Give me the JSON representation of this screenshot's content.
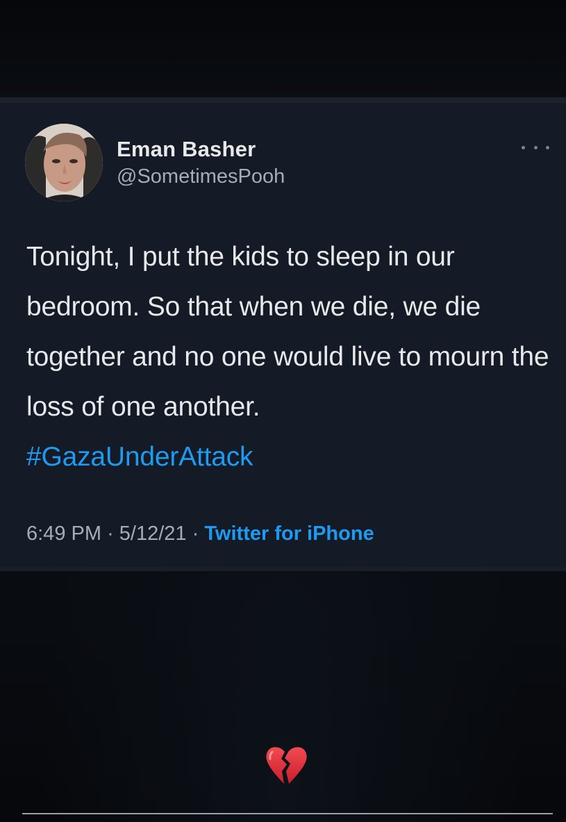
{
  "tweet": {
    "author": {
      "display_name": "Eman Basher",
      "handle": "@SometimesPooh"
    },
    "text": "Tonight, I put the kids to sleep in our bedroom. So that when we die, we die together and no one would live to mourn the loss of one another.",
    "hashtag": "#GazaUnderAttack",
    "time": "6:49 PM",
    "date": "5/12/21",
    "separator": "·",
    "source": "Twitter for iPhone",
    "more_icon": "more-horizontal-icon"
  },
  "reaction": {
    "emoji": "broken-heart-icon"
  },
  "colors": {
    "card_background": "#141a26",
    "text": "#e7e9ea",
    "secondary_text": "#a7adb4",
    "link": "#1d9bf0",
    "heart_red": "#e0303a"
  }
}
